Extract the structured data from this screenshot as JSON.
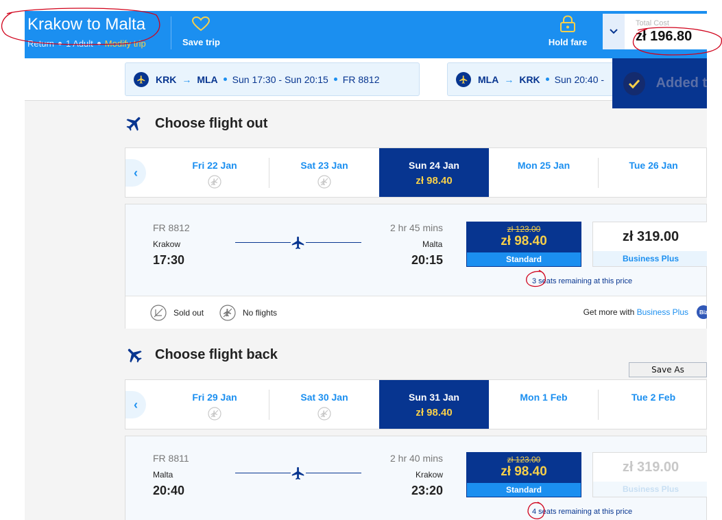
{
  "header": {
    "title": "Krakow to Malta",
    "trip_type": "Return",
    "passengers": "1 Adult",
    "modify_label": "Modify trip",
    "save_trip_label": "Save trip",
    "hold_fare_label": "Hold fare",
    "total_label": "Total Cost",
    "total_value": "zł 196.80"
  },
  "summary": {
    "outbound": {
      "from": "KRK",
      "to": "MLA",
      "times": "Sun 17:30 - Sun 20:15",
      "flight_no": "FR 8812"
    },
    "return": {
      "from": "MLA",
      "to": "KRK",
      "times": "Sun 20:40 -"
    }
  },
  "toast": {
    "text": "Added t"
  },
  "outbound": {
    "heading": "Choose flight out",
    "days": [
      {
        "label": "Fri 22 Jan",
        "price": "",
        "no_flights": true
      },
      {
        "label": "Sat 23 Jan",
        "price": "",
        "no_flights": true
      },
      {
        "label": "Sun 24 Jan",
        "price": "zł 98.40",
        "no_flights": false
      },
      {
        "label": "Mon 25 Jan",
        "price": "",
        "no_flights": false
      },
      {
        "label": "Tue 26 Jan",
        "price": "",
        "no_flights": false
      }
    ],
    "flight": {
      "number": "FR 8812",
      "duration": "2 hr 45 mins",
      "origin": "Krakow",
      "destination": "Malta",
      "depart": "17:30",
      "arrive": "20:15",
      "standard_old_price": "zł 123.00",
      "standard_price": "zł 98.40",
      "standard_label": "Standard",
      "business_price": "zł 319.00",
      "business_label": "Business Plus",
      "seats_note": "3 seats remaining at this price"
    },
    "legend": {
      "sold_out": "Sold out",
      "no_flights": "No flights",
      "get_more_prefix": "Get more with",
      "get_more_link": "Business Plus",
      "badge": "Biz"
    }
  },
  "inbound": {
    "heading": "Choose flight back",
    "save_as_label": "Save As",
    "days": [
      {
        "label": "Fri 29 Jan",
        "price": "",
        "no_flights": true
      },
      {
        "label": "Sat 30 Jan",
        "price": "",
        "no_flights": true
      },
      {
        "label": "Sun 31 Jan",
        "price": "zł 98.40",
        "no_flights": false
      },
      {
        "label": "Mon 1 Feb",
        "price": "",
        "no_flights": false
      },
      {
        "label": "Tue 2 Feb",
        "price": "",
        "no_flights": false
      }
    ],
    "flight": {
      "number": "FR 8811",
      "duration": "2 hr 40 mins",
      "origin": "Malta",
      "destination": "Krakow",
      "depart": "20:40",
      "arrive": "23:20",
      "standard_old_price": "zł 123.00",
      "standard_price": "zł 98.40",
      "standard_label": "Standard",
      "business_price": "zł 319.00",
      "business_label": "Business Plus",
      "seats_note": "4 seats remaining at this price"
    }
  },
  "colors": {
    "brand_blue": "#1b8ff0",
    "navy": "#073590",
    "gold": "#f7d04a",
    "annotation_red": "#d0021b"
  }
}
